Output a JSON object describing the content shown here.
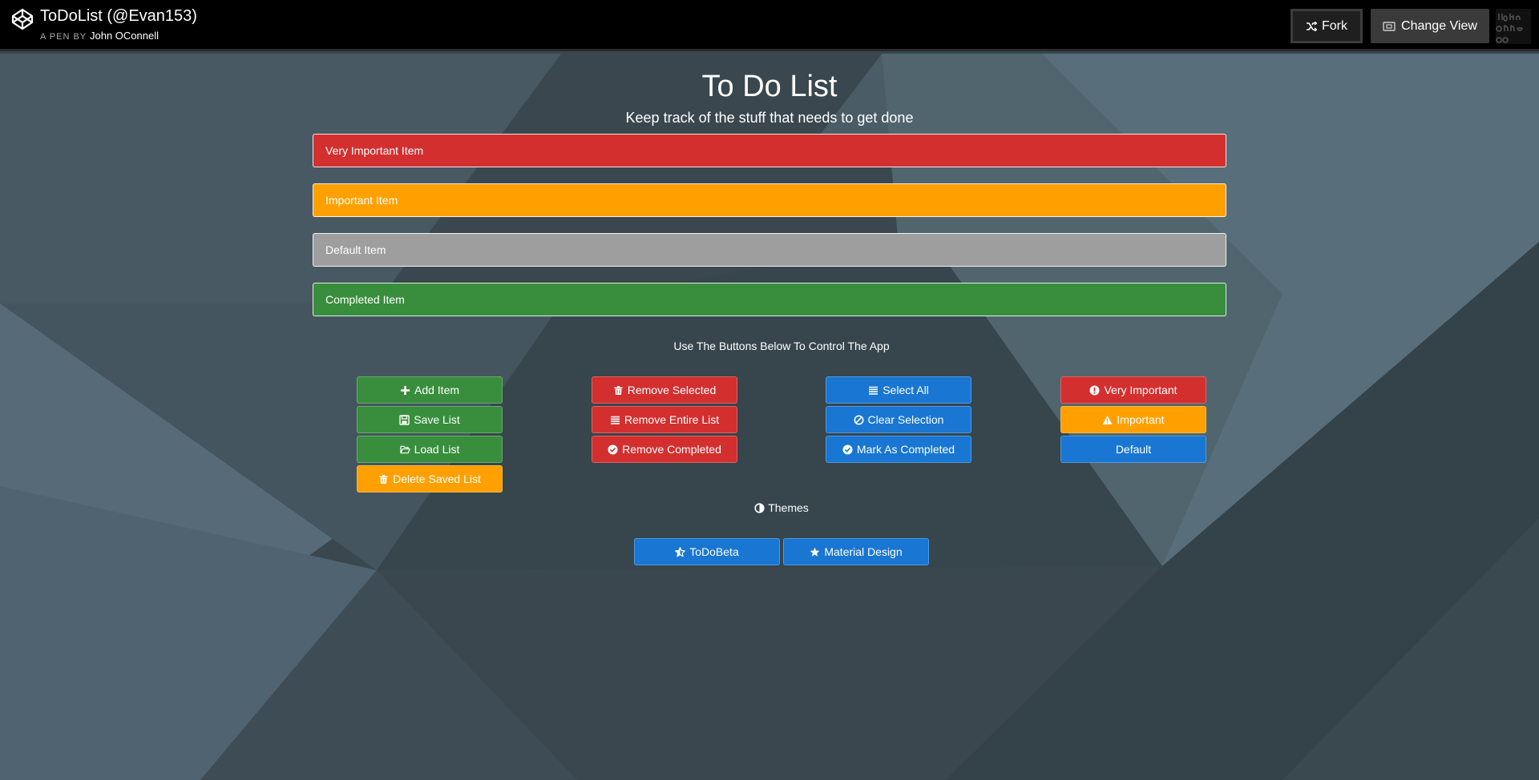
{
  "header": {
    "title": "ToDoList (@Evan153)",
    "by_label": "A PEN BY",
    "author": "John OConnell",
    "fork_label": "Fork",
    "change_view_label": "Change View"
  },
  "app": {
    "title": "To Do List",
    "subtitle": "Keep track of the stuff that needs to get done",
    "items": [
      {
        "label": "Very Important Item",
        "color": "#d32f2f"
      },
      {
        "label": "Important Item",
        "color": "#ffa000"
      },
      {
        "label": "Default Item",
        "color": "#9e9e9e"
      },
      {
        "label": "Completed Item",
        "color": "#388e3c"
      }
    ],
    "instructions": "Use The Buttons Below To Control The App",
    "buttons": {
      "add_item": "Add Item",
      "save_list": "Save List",
      "load_list": "Load List",
      "delete_saved_list": "Delete Saved List",
      "remove_selected": "Remove Selected",
      "remove_entire_list": "Remove Entire List",
      "remove_completed": "Remove Completed",
      "select_all": "Select All",
      "clear_selection": "Clear Selection",
      "mark_as_completed": "Mark As Completed",
      "very_important": "Very Important",
      "important": "Important",
      "default": "Default"
    },
    "themes_label": "Themes",
    "themes": {
      "todobeta": "ToDoBeta",
      "material_design": "Material Design"
    }
  },
  "colors": {
    "green": "#388e3c",
    "red": "#d32f2f",
    "blue": "#1976d2",
    "orange": "#ffa000",
    "grey": "#9e9e9e",
    "background": "#37474f"
  }
}
